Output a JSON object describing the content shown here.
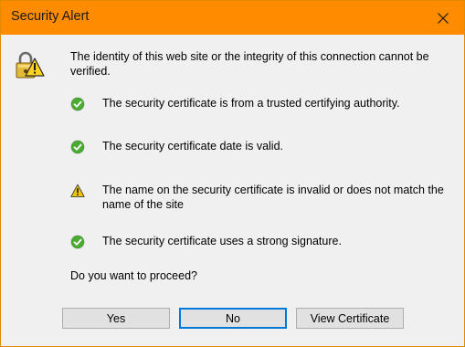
{
  "window": {
    "title": "Security Alert",
    "title_bar_color": "#ff8c00"
  },
  "intro": "The identity of this web site or the integrity of this connection cannot be verified.",
  "items": [
    {
      "icon": "check-icon",
      "text": "The security certificate is from a trusted certifying authority."
    },
    {
      "icon": "check-icon",
      "text": "The security certificate date is valid."
    },
    {
      "icon": "warning-icon",
      "text": "The name on the security certificate is invalid or does not match the name of the site"
    },
    {
      "icon": "check-icon",
      "text": "The security certificate uses a strong signature."
    }
  ],
  "question": "Do you want to proceed?",
  "buttons": {
    "yes": "Yes",
    "no": "No",
    "view": "View Certificate"
  },
  "colors": {
    "check_green": "#3f9a2a",
    "warning_yellow": "#f4c400",
    "default_button_border": "#0078d7"
  }
}
